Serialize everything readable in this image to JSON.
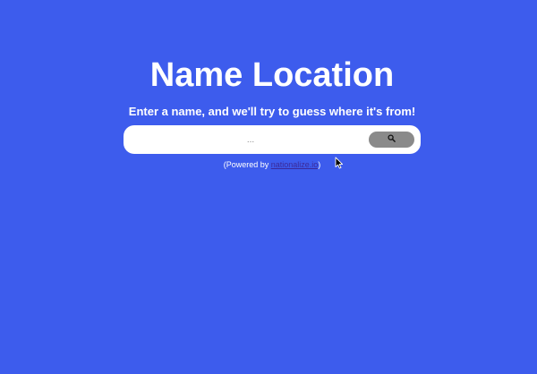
{
  "header": {
    "title": "Name Location",
    "subtitle": "Enter a name, and we'll try to guess where it's from!"
  },
  "search": {
    "placeholder": "...",
    "value": "",
    "button_icon": "search-icon"
  },
  "footer": {
    "powered_prefix": "(Powered by ",
    "link_text": "nationalize.io",
    "powered_suffix": ")"
  },
  "colors": {
    "background": "#3d5ced",
    "search_button": "#8a8a8a",
    "link": "#3b2a9a"
  },
  "icons": {
    "cursor": "mouse-pointer-icon"
  }
}
